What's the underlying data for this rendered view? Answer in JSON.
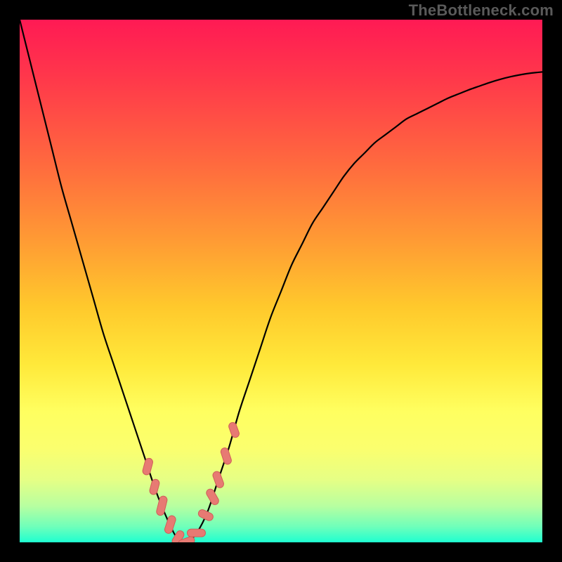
{
  "watermark": {
    "text": "TheBottleneck.com"
  },
  "colors": {
    "curve": "#000000",
    "marker_fill": "#e77a73",
    "marker_stroke": "#cf5f58",
    "gradient_top": "#ff1a54",
    "gradient_bottom": "#1effd0"
  },
  "chart_data": {
    "type": "line",
    "title": "",
    "xlabel": "",
    "ylabel": "",
    "xlim": [
      0,
      100
    ],
    "ylim": [
      0,
      100
    ],
    "x": [
      0,
      2,
      4,
      6,
      8,
      10,
      12,
      14,
      16,
      18,
      20,
      22,
      24,
      26,
      28,
      30,
      32,
      34,
      36,
      38,
      40,
      42,
      44,
      46,
      48,
      50,
      52,
      54,
      56,
      58,
      60,
      62,
      64,
      66,
      68,
      70,
      72,
      74,
      76,
      78,
      80,
      82,
      84,
      86,
      88,
      90,
      92,
      94,
      96,
      98,
      100
    ],
    "y": [
      100,
      92,
      84,
      76,
      68,
      61,
      54,
      47,
      40,
      34,
      28,
      22,
      16,
      10,
      5,
      1,
      0,
      2,
      6,
      12,
      18,
      25,
      31,
      37,
      43,
      48,
      53,
      57,
      61,
      64,
      67,
      70,
      72.5,
      74.5,
      76.5,
      78,
      79.5,
      81,
      82,
      83,
      84,
      85,
      85.8,
      86.6,
      87.3,
      88,
      88.6,
      89.1,
      89.5,
      89.8,
      90
    ],
    "note": "Curve estimated from pixels; minimum around x≈32 (plot fraction ~0.32)",
    "markers": [
      {
        "t": 0.245,
        "len": 24,
        "angle": -75
      },
      {
        "t": 0.258,
        "len": 22,
        "angle": -75
      },
      {
        "t": 0.272,
        "len": 28,
        "angle": -76
      },
      {
        "t": 0.288,
        "len": 26,
        "angle": -72
      },
      {
        "t": 0.303,
        "len": 22,
        "angle": -58
      },
      {
        "t": 0.319,
        "len": 24,
        "angle": -20
      },
      {
        "t": 0.338,
        "len": 26,
        "angle": 0
      },
      {
        "t": 0.356,
        "len": 22,
        "angle": 25
      },
      {
        "t": 0.369,
        "len": 24,
        "angle": 60
      },
      {
        "t": 0.38,
        "len": 24,
        "angle": 70
      },
      {
        "t": 0.395,
        "len": 24,
        "angle": 72
      },
      {
        "t": 0.41,
        "len": 22,
        "angle": 70
      }
    ]
  }
}
